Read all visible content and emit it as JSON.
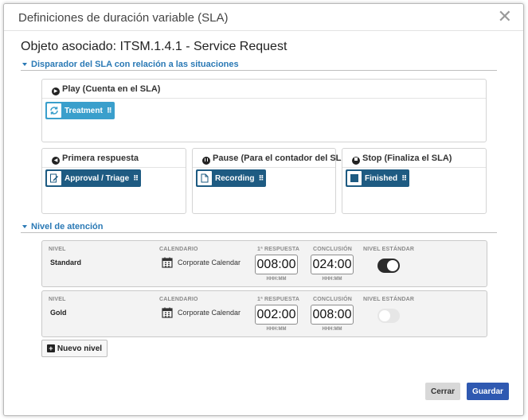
{
  "dialog": {
    "title": "Definiciones de duración variable (SLA)",
    "close_glyph": "✕"
  },
  "object_line": "Objeto asociado: ITSM.1.4.1 - Service Request",
  "trigger_section": {
    "title": "Disparador del SLA con relación a las situaciones",
    "play": {
      "title": "Play (Cuenta en el SLA)",
      "icon": "play-icon",
      "chips": [
        {
          "label": "Treatment",
          "icon": "refresh-icon"
        }
      ]
    },
    "first_response": {
      "title": "Primera respuesta",
      "icon": "first-response-icon",
      "chips": [
        {
          "label": "Approval / Triage",
          "icon": "edit-document-icon"
        }
      ]
    },
    "pause": {
      "title": "Pause (Para el contador del SLA)",
      "icon": "pause-icon",
      "chips": [
        {
          "label": "Recording",
          "icon": "document-icon"
        }
      ]
    },
    "stop": {
      "title": "Stop (Finaliza el SLA)",
      "icon": "stop-icon",
      "chips": [
        {
          "label": "Finished",
          "icon": "square-icon"
        }
      ]
    }
  },
  "level_section": {
    "title": "Nivel de atención",
    "labels": {
      "level": "NIVEL",
      "calendar": "CALENDARIO",
      "first_response": "1ª RESPUESTA",
      "conclusion": "CONCLUSIÓN",
      "standard_level": "NIVEL ESTÁNDAR",
      "time_format": "HHH:MM"
    },
    "levels": [
      {
        "name": "Standard",
        "calendar": "Corporate Calendar",
        "first_response": "008:00",
        "conclusion": "024:00",
        "is_standard": true
      },
      {
        "name": "Gold",
        "calendar": "Corporate Calendar",
        "first_response": "002:00",
        "conclusion": "008:00",
        "is_standard": false
      }
    ],
    "new_level_label": "Nuevo nivel"
  },
  "footer": {
    "cancel_label": "Cerrar",
    "save_label": "Guardar"
  },
  "colors": {
    "accent_blue": "#2a79b5",
    "chip_teal": "#3a9fcc",
    "chip_dark": "#1e5b82",
    "save_button": "#2f59b1",
    "toggle_on": "#2b2b2b",
    "toggle_off": "#e6e6e6"
  }
}
